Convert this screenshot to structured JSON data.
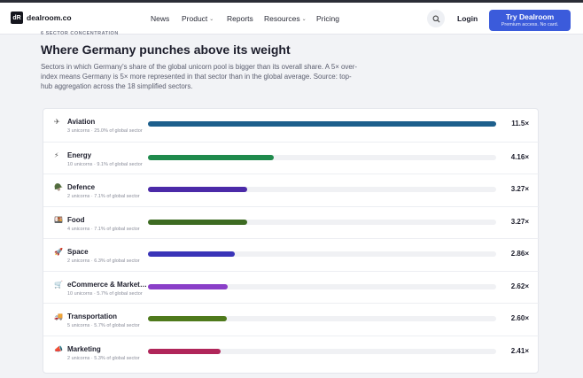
{
  "nav": {
    "logo_mark": "dR",
    "logo_text": "dealroom.co",
    "links": [
      {
        "label": "News",
        "caret": false
      },
      {
        "label": "Product",
        "caret": true
      },
      {
        "label": "Reports",
        "caret": false
      },
      {
        "label": "Resources",
        "caret": true
      },
      {
        "label": "Pricing",
        "caret": false
      }
    ],
    "search_icon": "search-icon",
    "login": "Login",
    "cta": {
      "title": "Try Dealroom",
      "subtitle": "Premium access. No card."
    }
  },
  "section": {
    "eyebrow": "6 SECTOR CONCENTRATION",
    "title": "Where Germany punches above its weight",
    "description": "Sectors in which Germany's share of the global unicorn pool is bigger than its overall share. A 5× over-index means Germany is 5× more represented in that sector than in the global average. Source: top-hub aggregation across the 18 simplified sectors."
  },
  "rows": [
    {
      "name": "Aviation",
      "icon": "✈",
      "icon_name": "plane-icon",
      "sub": "3 unicorns · 25.0% of global sector",
      "value": "11.5×",
      "ratio": 11.5,
      "color": "#1d5f8c"
    },
    {
      "name": "Energy",
      "icon": "⚡",
      "icon_name": "lightning-icon",
      "sub": "10 unicorns · 9.1% of global sector",
      "value": "4.16×",
      "ratio": 4.16,
      "color": "#1f8a4c"
    },
    {
      "name": "Defence",
      "icon": "🪖",
      "icon_name": "helmet-icon",
      "sub": "2 unicorns · 7.1% of global sector",
      "value": "3.27×",
      "ratio": 3.27,
      "color": "#4b2aa8"
    },
    {
      "name": "Food",
      "icon": "🍱",
      "icon_name": "food-icon",
      "sub": "4 unicorns · 7.1% of global sector",
      "value": "3.27×",
      "ratio": 3.27,
      "color": "#3d6b22"
    },
    {
      "name": "Space",
      "icon": "🚀",
      "icon_name": "rocket-icon",
      "sub": "2 unicorns · 6.3% of global sector",
      "value": "2.86×",
      "ratio": 2.86,
      "color": "#3a34b8"
    },
    {
      "name": "eCommerce & Market…",
      "icon": "🛒",
      "icon_name": "cart-icon",
      "sub": "10 unicorns · 5.7% of global sector",
      "value": "2.62×",
      "ratio": 2.62,
      "color": "#8a3fc8"
    },
    {
      "name": "Transportation",
      "icon": "🚚",
      "icon_name": "truck-icon",
      "sub": "5 unicorns · 5.7% of global sector",
      "value": "2.60×",
      "ratio": 2.6,
      "color": "#4f7a1c"
    },
    {
      "name": "Marketing",
      "icon": "📣",
      "icon_name": "megaphone-icon",
      "sub": "2 unicorns · 5.3% of global sector",
      "value": "2.41×",
      "ratio": 2.41,
      "color": "#b0265a"
    }
  ],
  "scale_max": 11.5
}
